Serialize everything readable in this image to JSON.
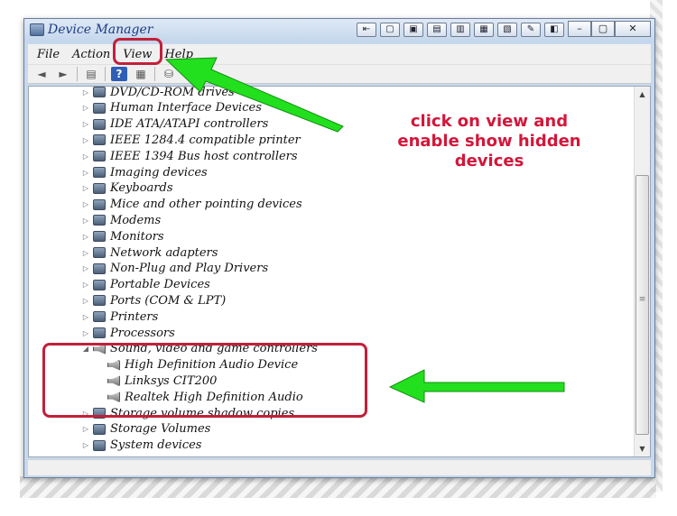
{
  "window": {
    "title": "Device Manager",
    "toolbar_buttons": [
      "⇤",
      "▢",
      "▣",
      "▤",
      "▥",
      "▦",
      "▧",
      "✎",
      "◧"
    ],
    "controls": {
      "minimize": "–",
      "maximize": "▢",
      "close": "✕"
    }
  },
  "menu": {
    "items": [
      {
        "name": "menu-file",
        "label": "File"
      },
      {
        "name": "menu-action",
        "label": "Action"
      },
      {
        "name": "menu-view",
        "label": "View"
      },
      {
        "name": "menu-help",
        "label": "Help"
      }
    ]
  },
  "toolbar": {
    "back_icon": "◄",
    "forward_icon": "►",
    "properties_icon": "▤",
    "help_icon": "?",
    "update_icon": "▦",
    "scan_icon": "⛁"
  },
  "tree": {
    "items": [
      {
        "label": "DVD/CD-ROM drives",
        "level": 0,
        "expanded": false
      },
      {
        "label": "Human Interface Devices",
        "level": 0,
        "expanded": false
      },
      {
        "label": "IDE ATA/ATAPI controllers",
        "level": 0,
        "expanded": false
      },
      {
        "label": "IEEE 1284.4 compatible printer",
        "level": 0,
        "expanded": false
      },
      {
        "label": "IEEE 1394 Bus host controllers",
        "level": 0,
        "expanded": false
      },
      {
        "label": "Imaging devices",
        "level": 0,
        "expanded": false
      },
      {
        "label": "Keyboards",
        "level": 0,
        "expanded": false
      },
      {
        "label": "Mice and other pointing devices",
        "level": 0,
        "expanded": false
      },
      {
        "label": "Modems",
        "level": 0,
        "expanded": false
      },
      {
        "label": "Monitors",
        "level": 0,
        "expanded": false
      },
      {
        "label": "Network adapters",
        "level": 0,
        "expanded": false
      },
      {
        "label": "Non-Plug and Play Drivers",
        "level": 0,
        "expanded": false
      },
      {
        "label": "Portable Devices",
        "level": 0,
        "expanded": false
      },
      {
        "label": "Ports (COM & LPT)",
        "level": 0,
        "expanded": false
      },
      {
        "label": "Printers",
        "level": 0,
        "expanded": false
      },
      {
        "label": "Processors",
        "level": 0,
        "expanded": false
      },
      {
        "label": "Sound, video and game controllers",
        "level": 0,
        "expanded": true
      },
      {
        "label": "High Definition Audio Device",
        "level": 1
      },
      {
        "label": "Linksys CIT200",
        "level": 1
      },
      {
        "label": "Realtek High Definition Audio",
        "level": 1
      },
      {
        "label": "Storage volume shadow copies",
        "level": 0,
        "expanded": false
      },
      {
        "label": "Storage Volumes",
        "level": 0,
        "expanded": false
      },
      {
        "label": "System devices",
        "level": 0,
        "expanded": false
      }
    ]
  },
  "scrollbar": {
    "up": "▲",
    "down": "▼",
    "grip": "≡"
  },
  "annotation": {
    "text": "click on view and enable show hidden devices",
    "color": "#d3163a",
    "box_color": "#c2203a",
    "arrow_color": "#22e01e"
  }
}
